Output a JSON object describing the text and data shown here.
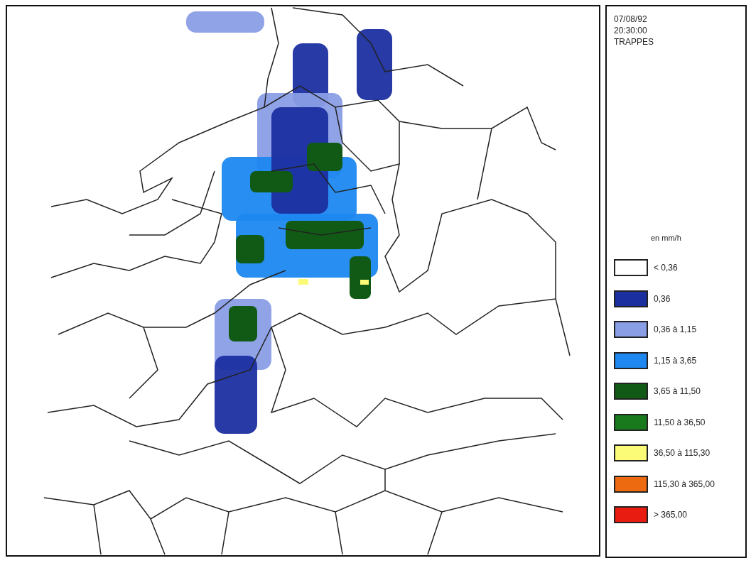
{
  "info": {
    "date": "07/08/92",
    "time": "20:30:00",
    "station": "TRAPPES"
  },
  "legend": {
    "unit": "en mm/h",
    "items": [
      {
        "label": "< 0,36",
        "color": "#ffffff"
      },
      {
        "label": "0,36",
        "color": "#1c2fa0"
      },
      {
        "label": "0,36 à 1,15",
        "color": "#8a9ee6"
      },
      {
        "label": "1,15 à 3,65",
        "color": "#1e88f0"
      },
      {
        "label": "3,65 à 11,50",
        "color": "#115a16"
      },
      {
        "label": "11,50 à 36,50",
        "color": "#187a1c"
      },
      {
        "label": "36,50 à 115,30",
        "color": "#fbfb78"
      },
      {
        "label": "115,30 à 365,00",
        "color": "#ee6a10"
      },
      {
        "label": "> 365,00",
        "color": "#e81c10"
      }
    ]
  }
}
